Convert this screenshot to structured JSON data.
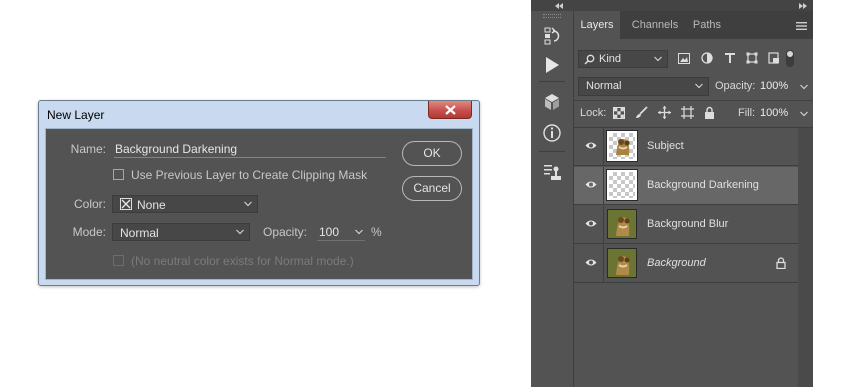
{
  "dialog": {
    "title": "New Layer",
    "name_label": "Name:",
    "name_value": "Background Darkening",
    "clipping_label": "Use Previous Layer to Create Clipping Mask",
    "color_label": "Color:",
    "color_value": "None",
    "mode_label": "Mode:",
    "mode_value": "Normal",
    "opacity_label": "Opacity:",
    "opacity_value": "100",
    "opacity_unit": "%",
    "neutral_note": "(No neutral color exists for Normal mode.)",
    "ok_label": "OK",
    "cancel_label": "Cancel"
  },
  "panel": {
    "tabs": [
      "Layers",
      "Channels",
      "Paths"
    ],
    "filter_label": "Kind",
    "blend_mode": "Normal",
    "opacity_label": "Opacity:",
    "opacity_value": "100%",
    "lock_label": "Lock:",
    "fill_label": "Fill:",
    "fill_value": "100%",
    "layers": [
      {
        "name": "Subject",
        "selected": false,
        "italic": false,
        "locked": false
      },
      {
        "name": "Background Darkening",
        "selected": true,
        "italic": false,
        "locked": false
      },
      {
        "name": "Background Blur",
        "selected": false,
        "italic": false,
        "locked": false
      },
      {
        "name": "Background",
        "selected": false,
        "italic": true,
        "locked": true
      }
    ]
  },
  "colors": {
    "panel_bg": "#535353",
    "selected_layer": "#676767",
    "dialog_frame": "#c9daf0",
    "accent_underline": "#4d8fd6",
    "close_red": "#c75050"
  }
}
